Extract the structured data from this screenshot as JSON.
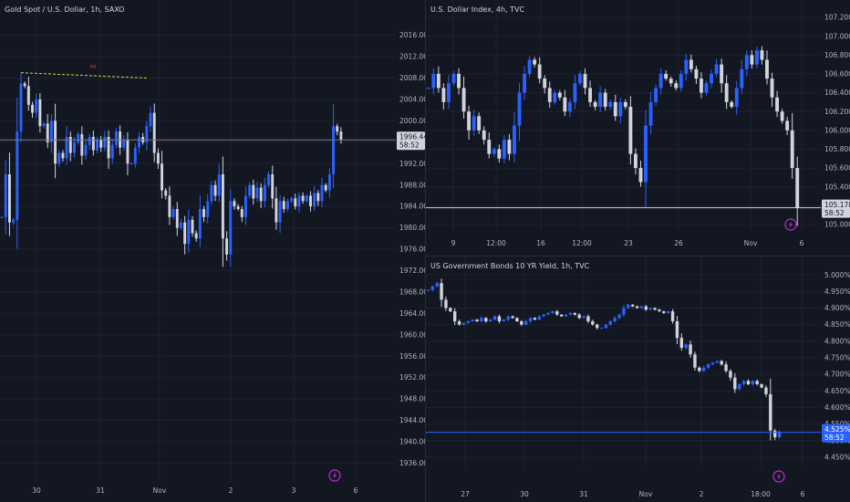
{
  "colors": {
    "background": "#131722",
    "grid": "#1e2230",
    "axis_text": "#b2b5be",
    "up_candle": "#2962ff",
    "down_candle": "#d1d4dc",
    "divider": "#2a2e39",
    "event_icon": "#c22bd4",
    "annotation_line": "#cddc39",
    "annotation_text": "#f23645",
    "price_tag_bg": "#d1d4dc",
    "price_tag_text": "#131722",
    "yield_tag_bg": "#2962ff",
    "yield_tag_text": "#ffffff"
  },
  "panes": {
    "gold": {
      "title": "Gold Spot / U.S. Dollar, 1h, SAXO",
      "price_label": "1996.44",
      "countdown": "58:52",
      "event_icon": "lightning-icon",
      "annotation_text": "xx"
    },
    "dxy": {
      "title": "U.S. Dollar Index, 4h, TVC",
      "price_label": "105.178",
      "countdown": "58:52",
      "event_icon": "lightning-icon"
    },
    "us10y": {
      "title": "US Government Bonds 10 YR Yield, 1h, TVC",
      "price_label": "4.525%",
      "countdown": "58:52",
      "event_icon": "lightning-icon"
    }
  },
  "chart_data": [
    {
      "type": "candlestick",
      "title": "Gold Spot / U.S. Dollar, 1h, SAXO",
      "x_ticks": [
        "30",
        "31",
        "Nov",
        "2",
        "3",
        "6"
      ],
      "y_ticks": [
        "2016.00",
        "2012.00",
        "2008.00",
        "2004.00",
        "2000.00",
        "1996.00",
        "1992.00",
        "1988.00",
        "1984.00",
        "1980.00",
        "1976.00",
        "1972.00",
        "1968.00",
        "1964.00",
        "1960.00",
        "1956.00",
        "1952.00",
        "1948.00",
        "1944.00",
        "1940.00",
        "1936.00"
      ],
      "ylim": [
        1933.5,
        2018.5
      ],
      "last_price": 1996.44,
      "annotation": {
        "text": "xx",
        "from_price": 2009,
        "to_price": 2008
      },
      "closes": [
        1982.0,
        1990.0,
        1981.0,
        1981.5,
        1998.0,
        2007.0,
        2006.5,
        2003.0,
        2001.5,
        2004.0,
        1999.0,
        1999.5,
        1996.0,
        2000.0,
        1992.0,
        1994.0,
        1993.0,
        1997.0,
        1994.0,
        1996.0,
        1997.5,
        1993.5,
        1995.5,
        1997.0,
        1994.5,
        1996.5,
        1995.0,
        1997.0,
        1993.0,
        1995.5,
        1998.0,
        1995.0,
        1996.5,
        1992.0,
        1992.0,
        1995.0,
        1997.0,
        1996.0,
        1999.0,
        2001.5,
        1994.0,
        1992.0,
        1987.0,
        1986.0,
        1982.0,
        1983.5,
        1980.0,
        1981.0,
        1977.0,
        1981.5,
        1979.0,
        1978.0,
        1983.5,
        1982.0,
        1985.0,
        1988.0,
        1986.0,
        1990.0,
        1978.0,
        1975.0,
        1985.0,
        1984.0,
        1983.5,
        1982.0,
        1986.0,
        1988.0,
        1985.5,
        1987.5,
        1985.0,
        1988.0,
        1990.0,
        1985.5,
        1981.0,
        1985.0,
        1983.5,
        1985.0,
        1985.5,
        1984.0,
        1986.0,
        1985.0,
        1986.0,
        1984.0,
        1986.5,
        1985.0,
        1988.0,
        1987.0,
        1990.0,
        1999.0,
        1998.0,
        1996.44
      ]
    },
    {
      "type": "candlestick",
      "title": "U.S. Dollar Index, 4h, TVC",
      "x_ticks": [
        "9",
        "12:00",
        "16",
        "12:00",
        "23",
        "26",
        "Nov",
        "6"
      ],
      "y_ticks": [
        "107.200",
        "107.000",
        "106.800",
        "106.600",
        "106.400",
        "106.200",
        "106.000",
        "105.800",
        "105.600",
        "105.400",
        "105.200",
        "105.000"
      ],
      "ylim": [
        104.98,
        107.22
      ],
      "last_price": 105.178,
      "closes": [
        106.45,
        106.6,
        106.45,
        106.3,
        106.5,
        106.6,
        106.45,
        106.2,
        106.0,
        106.15,
        106.0,
        105.9,
        105.75,
        105.8,
        105.7,
        105.9,
        105.75,
        106.05,
        106.4,
        106.6,
        106.75,
        106.7,
        106.55,
        106.45,
        106.3,
        106.4,
        106.35,
        106.2,
        106.3,
        106.5,
        106.6,
        106.45,
        106.3,
        106.25,
        106.4,
        106.25,
        106.3,
        106.15,
        106.3,
        106.25,
        105.75,
        105.6,
        105.45,
        106.05,
        106.3,
        106.45,
        106.6,
        106.55,
        106.5,
        106.45,
        106.6,
        106.75,
        106.65,
        106.55,
        106.4,
        106.5,
        106.6,
        106.7,
        106.5,
        106.3,
        106.25,
        106.45,
        106.65,
        106.8,
        106.7,
        106.85,
        106.75,
        106.55,
        106.35,
        106.2,
        106.1,
        106.0,
        105.6,
        105.178
      ]
    },
    {
      "type": "candlestick",
      "title": "US Government Bonds 10 YR Yield, 1h, TVC",
      "x_ticks": [
        "27",
        "30",
        "31",
        "Nov",
        "2",
        "18:00",
        "6"
      ],
      "y_ticks": [
        "5.000%",
        "4.950%",
        "4.900%",
        "4.850%",
        "4.800%",
        "4.750%",
        "4.700%",
        "4.650%",
        "4.600%",
        "4.550%",
        "4.500%",
        "4.450%"
      ],
      "ylim": [
        4.433,
        5.017
      ],
      "last_price": 4.525,
      "closes": [
        4.955,
        4.965,
        4.975,
        4.925,
        4.9,
        4.89,
        4.86,
        4.85,
        4.855,
        4.86,
        4.865,
        4.86,
        4.87,
        4.86,
        4.865,
        4.875,
        4.86,
        4.865,
        4.875,
        4.87,
        4.86,
        4.85,
        4.86,
        4.87,
        4.865,
        4.875,
        4.88,
        4.885,
        4.89,
        4.88,
        4.875,
        4.88,
        4.885,
        4.88,
        4.87,
        4.875,
        4.86,
        4.85,
        4.84,
        4.84,
        4.85,
        4.86,
        4.87,
        4.88,
        4.9,
        4.91,
        4.905,
        4.9,
        4.905,
        4.895,
        4.9,
        4.895,
        4.89,
        4.885,
        4.89,
        4.86,
        4.81,
        4.78,
        4.79,
        4.76,
        4.72,
        4.71,
        4.72,
        4.73,
        4.735,
        4.74,
        4.73,
        4.71,
        4.69,
        4.655,
        4.67,
        4.68,
        4.67,
        4.68,
        4.67,
        4.66,
        4.64,
        4.53,
        4.51,
        4.525
      ]
    }
  ]
}
